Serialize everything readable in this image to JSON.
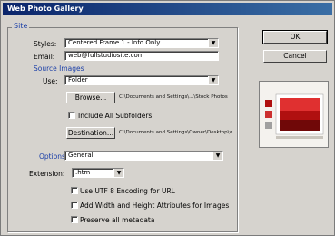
{
  "window": {
    "title": "Web Photo Gallery"
  },
  "site_group": {
    "title": "Site"
  },
  "styles": {
    "label": "Styles:",
    "value": "Centered Frame 1 - Info Only"
  },
  "email": {
    "label": "Email:",
    "value": "web@fullstudiosite.com"
  },
  "source_images": {
    "title": "Source Images",
    "use_label": "Use:",
    "use_value": "Folder",
    "browse_label": "Browse...",
    "browse_path": "C:\\Documents and Settings\\...\\Stock Photos",
    "include_subfolders_label": "Include All Subfolders",
    "destination_label": "Destination...",
    "destination_path": "C:\\Documents and Settings\\Owner\\Desktop\\web"
  },
  "options": {
    "label": "Options:",
    "value": "General"
  },
  "extension": {
    "label": "Extension:",
    "value": ".htm"
  },
  "checkboxes": [
    {
      "label": "Use UTF 8 Encoding for URL",
      "checked": false
    },
    {
      "label": "Add Width and Height Attributes for Images",
      "checked": false
    },
    {
      "label": "Preserve all metadata",
      "checked": false
    }
  ],
  "buttons": {
    "ok": "OK",
    "cancel": "Cancel"
  },
  "colors": {
    "title_bar": "#0a246a",
    "group_title": "#1b3fa8",
    "dialog_bg": "#d6d3ce",
    "preview_red": "#b01010"
  }
}
